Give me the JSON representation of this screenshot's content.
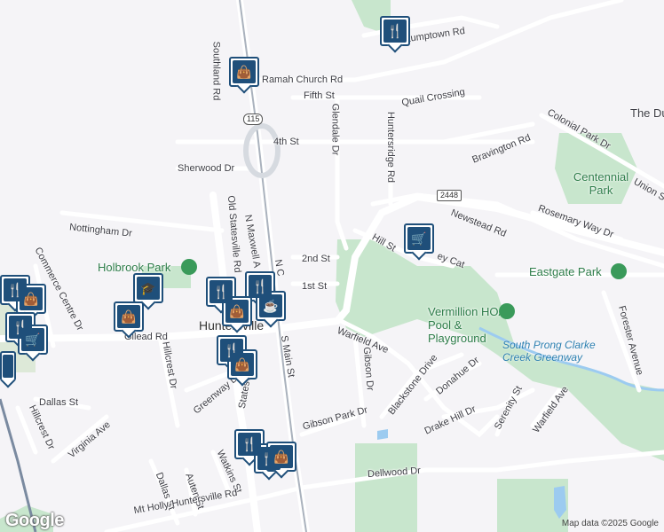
{
  "map": {
    "roads": {
      "rocky_river_rd": "Stumptown Rd",
      "ramah_church": "Ramah Church Rd",
      "fifth": "Fifth St",
      "quail": "Quail Crossing",
      "glendale": "Glendale Dr",
      "huntersridge": "Huntersridge Rd",
      "colonial": "Colonial Park Dr",
      "bravington": "Bravington Rd",
      "fourth": "4th St",
      "sherwood": "Sherwood Dr",
      "southland": "Southland Rd",
      "newstead": "Newstead Rd",
      "rosemary": "Rosemary Way Dr",
      "union": "Union S",
      "nottingham": "Nottingham Dr",
      "second": "2nd St",
      "hill": "Hill St",
      "bobcat": "ey Cat",
      "old_statesville": "Old Statesville Rd",
      "n_maxwell": "N Maxwell A",
      "n_church": "N C",
      "first": "1st St",
      "commerce": "Commerce Centre Dr",
      "gilead": "Gilead Rd",
      "s_main": "S Main St",
      "warfield": "Warfield Ave",
      "gibson": "Gibson Dr",
      "blackstone": "Blackstone Drive",
      "donahue": "Donahue Dr",
      "hillcrest": "Hillcrest Dr",
      "hillcrest2": "Hillcrest Dr",
      "greenway": "Greenway Dr",
      "statesville": "Statesville",
      "dallas": "Dallas St",
      "virginia": "Virginia Ave",
      "gibson_park": "Gibson Park Dr",
      "drake_hill": "Drake Hill Dr",
      "serenity": "Serenity St",
      "warfield2": "Warfield Ave",
      "forester": "Forester Avenue",
      "watkins": "Watkins St",
      "auten": "Auten St",
      "dallas2": "Dallas St",
      "mt_holly": "Mt Holly-Huntersville Rd",
      "dellwood": "Dellwood Dr"
    },
    "shields": {
      "nc115": "115",
      "sr2448": "2448"
    },
    "town": "Huntersville",
    "parks": {
      "holbrook": "Holbrook Park",
      "centennial": "Centennial Park",
      "eastgate": "Eastgate Park",
      "vermillion": "Vermillion HOA Pool & Playground",
      "the_du": "The Du"
    },
    "water": {
      "south_prong": "South Prong Clarke Creek Greenway"
    },
    "pins": [
      {
        "icon": "restaurant-icon",
        "label": "restaurant"
      },
      {
        "icon": "shopping-bag-icon",
        "label": "shopping"
      },
      {
        "icon": "shopping-cart-icon",
        "label": "grocery"
      },
      {
        "icon": "school-icon",
        "label": "school"
      },
      {
        "icon": "coffee-icon",
        "label": "cafe"
      }
    ]
  },
  "footer": {
    "logo": "Google",
    "attribution": "Map data ©2025 Google"
  },
  "colors": {
    "background": "#f5f4f7",
    "park": "#c8e6cd",
    "road": "#ffffff",
    "highway": "#aab2bd",
    "water": "#9ccbf0",
    "pin_border": "#1f4f7a",
    "rail": "#7a8aa0"
  }
}
